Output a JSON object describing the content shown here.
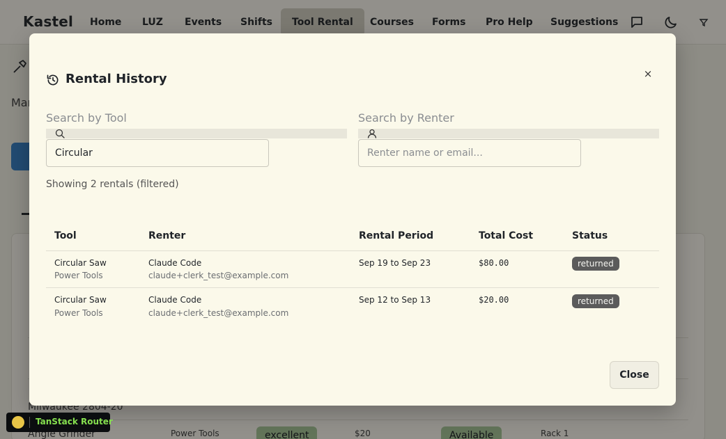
{
  "app": {
    "brand": "Kastel",
    "nav": [
      "Home",
      "LUZ",
      "Events",
      "Shifts",
      "Tool Rental",
      "Courses",
      "Forms",
      "Pro Help",
      "Suggestions"
    ],
    "active_nav": "Tool Rental",
    "nav_icons": [
      "chat-icon",
      "moon-icon",
      "filter-icon"
    ]
  },
  "background": {
    "partial_text": "Mar",
    "rows": [
      {
        "tool": "Milwaukee 2804-20"
      },
      {
        "tool": "Angle Grinder",
        "category": "Power Tools",
        "condition": "excellent",
        "price": "$20",
        "availability": "Available",
        "location": "Rack 1"
      }
    ]
  },
  "modal": {
    "title": "Rental History",
    "close_x": "×",
    "search_tool": {
      "label": "Search by Tool",
      "value": "Circular",
      "placeholder": ""
    },
    "search_renter": {
      "label": "Search by Renter",
      "value": "",
      "placeholder": "Renter name or email..."
    },
    "showing": "Showing 2 rentals (filtered)",
    "columns": [
      "Tool",
      "Renter",
      "Rental Period",
      "Total Cost",
      "Status"
    ],
    "rows": [
      {
        "tool": "Circular Saw",
        "category": "Power Tools",
        "renter": "Claude Code",
        "email": "claude+clerk_test@example.com",
        "period": "Sep 19 to Sep 23",
        "cost": "$80.00",
        "status": "returned"
      },
      {
        "tool": "Circular Saw",
        "category": "Power Tools",
        "renter": "Claude Code",
        "email": "claude+clerk_test@example.com",
        "period": "Sep 12 to Sep 13",
        "cost": "$20.00",
        "status": "returned"
      }
    ],
    "close_button": "Close"
  },
  "devtools": {
    "label": "TanStack Router"
  },
  "colors": {
    "page_bg": "#f3f1e6",
    "modal_bg": "#fbf9ea",
    "active_nav_bg": "#d4d0c3",
    "badge_bg": "#5b5b5b",
    "accent_blue": "#3b82c4",
    "chip_green": "#a9c89a",
    "devtools_text": "#86e04f"
  }
}
